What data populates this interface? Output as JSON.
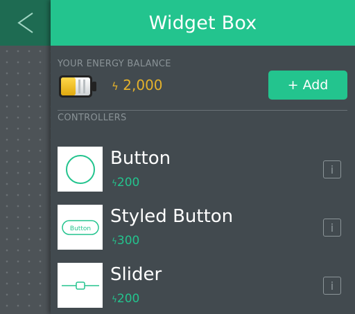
{
  "header": {
    "title": "Widget Box",
    "back_icon": "back-arrow-icon"
  },
  "energy": {
    "label": "YOUR ENERGY BALANCE",
    "amount": "2,000",
    "add_label": "+ Add",
    "level": 0.5
  },
  "controllers": {
    "label": "CONTROLLERS",
    "items": [
      {
        "name": "Button",
        "cost": "200",
        "thumb_icon": "button-circle-icon"
      },
      {
        "name": "Styled Button",
        "cost": "300",
        "thumb_icon": "styled-button-icon",
        "thumb_text": "Button"
      },
      {
        "name": "Slider",
        "cost": "200",
        "thumb_icon": "slider-icon"
      }
    ],
    "info_label": "i"
  },
  "colors": {
    "accent": "#23c48e",
    "header_dark": "#1e6b52",
    "energy": "#e5b22b",
    "drawer_bg": "#424a4f"
  }
}
